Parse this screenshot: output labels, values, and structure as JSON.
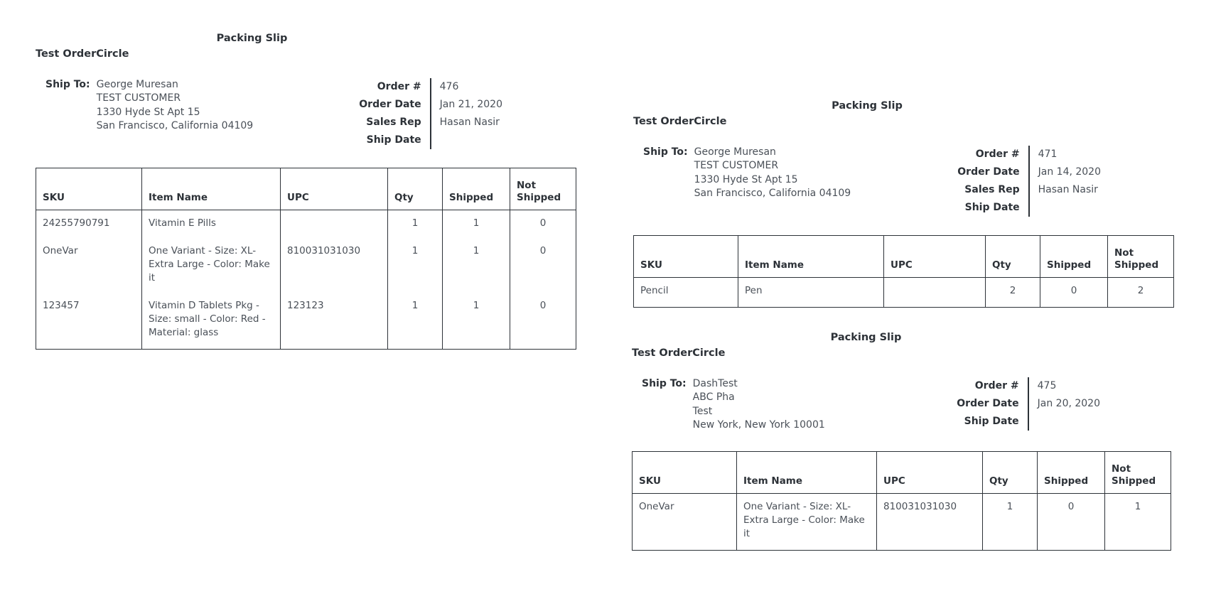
{
  "labels": {
    "packing_slip": "Packing Slip",
    "ship_to": "Ship To:",
    "order_number": "Order #",
    "order_date": "Order Date",
    "sales_rep": "Sales Rep",
    "ship_date": "Ship Date"
  },
  "columns": {
    "sku": "SKU",
    "item_name": "Item Name",
    "upc": "UPC",
    "qty": "Qty",
    "shipped": "Shipped",
    "not_shipped": "Not Shipped"
  },
  "slips": [
    {
      "company": "Test OrderCircle",
      "ship_to": {
        "line1": "George Muresan",
        "line2": "TEST CUSTOMER",
        "line3": "1330 Hyde St Apt 15",
        "line4": "San Francisco, California 04109"
      },
      "meta": {
        "order_number": "476",
        "order_date": "Jan 21, 2020",
        "sales_rep": "Hasan Nasir",
        "ship_date": ""
      },
      "items": [
        {
          "sku": "24255790791",
          "item_name": "Vitamin E Pills",
          "upc": "",
          "qty": "1",
          "shipped": "1",
          "not_shipped": "0"
        },
        {
          "sku": "OneVar",
          "item_name": "One Variant - Size: XL-Extra Large - Color: Make it",
          "upc": "810031031030",
          "qty": "1",
          "shipped": "1",
          "not_shipped": "0"
        },
        {
          "sku": "123457",
          "item_name": "Vitamin D Tablets Pkg - Size: small - Color: Red - Material: glass",
          "upc": "123123",
          "qty": "1",
          "shipped": "1",
          "not_shipped": "0"
        }
      ]
    },
    {
      "company": "Test OrderCircle",
      "ship_to": {
        "line1": "George Muresan",
        "line2": "TEST CUSTOMER",
        "line3": "1330 Hyde St Apt 15",
        "line4": "San Francisco, California 04109"
      },
      "meta": {
        "order_number": "471",
        "order_date": "Jan 14, 2020",
        "sales_rep": "Hasan Nasir",
        "ship_date": ""
      },
      "items": [
        {
          "sku": "Pencil",
          "item_name": "Pen",
          "upc": "",
          "qty": "2",
          "shipped": "0",
          "not_shipped": "2"
        }
      ]
    },
    {
      "company": "Test OrderCircle",
      "ship_to": {
        "line1": "DashTest",
        "line2": "ABC Pha",
        "line3": "Test",
        "line4": "New York, New York 10001"
      },
      "meta": {
        "order_number": "475",
        "order_date": "Jan 20, 2020",
        "ship_date": ""
      },
      "items": [
        {
          "sku": "OneVar",
          "item_name": "One Variant - Size: XL-Extra Large - Color: Make it",
          "upc": "810031031030",
          "qty": "1",
          "shipped": "0",
          "not_shipped": "1"
        }
      ]
    }
  ]
}
